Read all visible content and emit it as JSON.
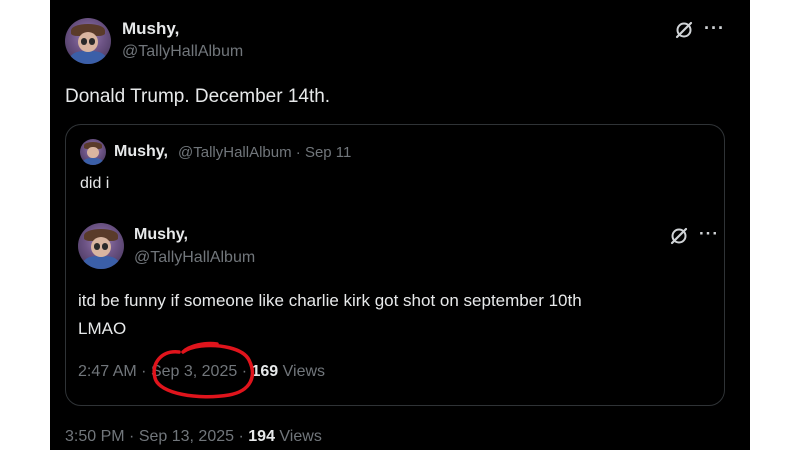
{
  "tweet": {
    "author_name": "Mushy,",
    "author_handle": "@TallyHallAlbum",
    "text": "Donald Trump. December 14th.",
    "time": "3:50 PM",
    "date": "Sep 13, 2025",
    "views_count": "194",
    "views_label": "Views",
    "separator": "·",
    "grok_icon": "grok-icon",
    "more_icon": "more-options-icon",
    "more_glyph": "···"
  },
  "quoted": {
    "author_name": "Mushy,",
    "author_handle": "@TallyHallAlbum",
    "date": "Sep 11",
    "separator": "·",
    "text": "did i"
  },
  "inner_tweet": {
    "author_name": "Mushy,",
    "author_handle": "@TallyHallAlbum",
    "text_line1": "itd be funny if someone like charlie kirk got shot on september 10th",
    "text_line2": "LMAO",
    "time": "2:47 AM",
    "date": "Sep 3, 2025",
    "views_count": "169",
    "views_label": "Views",
    "separator": "·",
    "grok_icon": "grok-icon",
    "more_icon": "more-options-icon",
    "more_glyph": "···"
  },
  "colors": {
    "background": "#000000",
    "text": "#e7e9ea",
    "muted": "#71767b",
    "border": "#2f3336",
    "annotation_red": "#e0141c"
  }
}
